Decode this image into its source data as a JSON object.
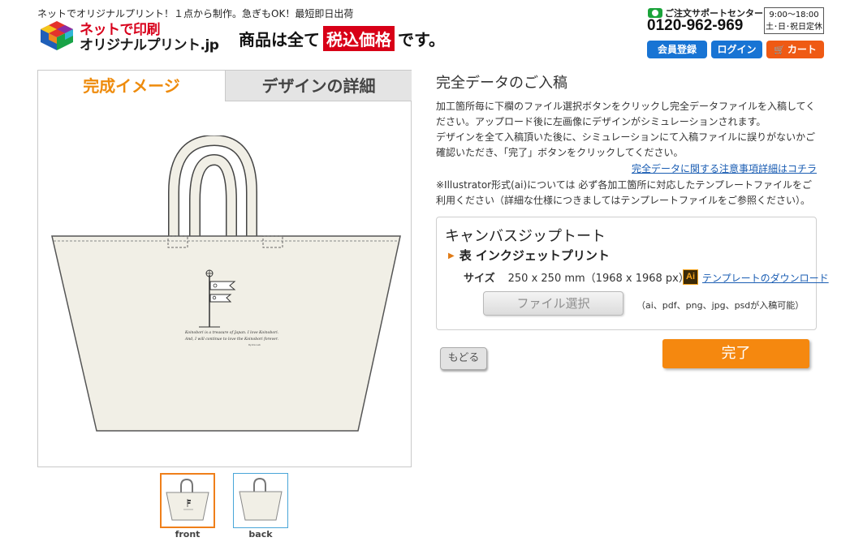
{
  "header": {
    "tagline": "ネットでオリジナルプリント！１点から制作。急ぎもOK！最短即日出荷",
    "logo_line1": "ネットで印刷",
    "logo_line2": "オリジナルプリント.jp",
    "tax_prefix": "商品は全て",
    "tax_badge": "税込価格",
    "tax_suffix": "です。",
    "support_label": "ご注文サポートセンター",
    "phone": "0120-962-969",
    "hours_line1": "9:00～18:00",
    "hours_line2": "土･日･祝日定休",
    "register_label": "会員登録",
    "login_label": "ログイン",
    "cart_label": "カート",
    "colors": {
      "brand_red": "#d80017",
      "button_blue": "#1874d4",
      "cart_orange": "#ef5a14"
    }
  },
  "preview": {
    "tab_complete": "完成イメージ",
    "tab_design": "デザインの詳細",
    "print_text_line1": "Koinobori is a treasure of Japan. I love Koinobori.",
    "print_text_line2": "And, I will continue to love the Koinobori forever.",
    "print_signature": "Ryota Lab",
    "thumbnails": [
      {
        "label": "front",
        "selected": true
      },
      {
        "label": "back",
        "selected": false
      }
    ]
  },
  "upload": {
    "title": "完全データのご入稿",
    "instructions_1": "加工箇所毎に下欄のファイル選択ボタンをクリックし完全データファイルを入稿してください。アップロード後に左画像にデザインがシミュレーションされます。",
    "instructions_2": "デザインを全て入稿頂いた後に、シミュレーションにて入稿ファイルに誤りがないかご確認いただき、「完了」ボタンをクリックしてください。",
    "notes_link": "完全データに関する注意事項詳細はコチラ",
    "ai_note": "※Illustrator形式(ai)については 必ず各加工箇所に対応したテンプレートファイルをご利用ください（詳細な仕様につきましてはテンプレートファイルをご参照ください）。",
    "product_name": "キャンバスジップトート",
    "side_label": "表 インクジェットプリント",
    "size_label": "サイズ",
    "size_value": "250 x 250 mm（1968 x 1968 px）",
    "ai_icon_text": "Ai",
    "template_link": "テンプレートのダウンロード",
    "file_button": "ファイル選択",
    "formats_note": "（ai、pdf、png、jpg、psdが入稿可能）",
    "back_button": "もどる",
    "done_button": "完了"
  }
}
